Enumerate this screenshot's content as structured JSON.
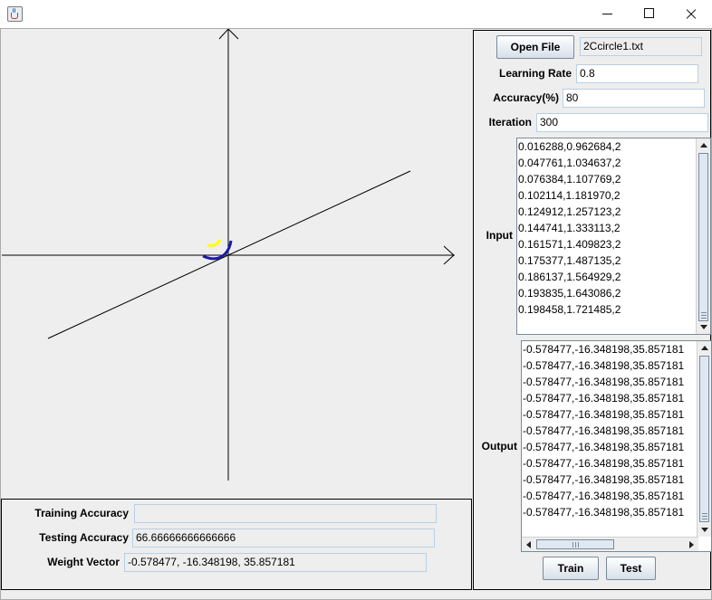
{
  "window": {
    "icon": "java-cup-icon",
    "controls": [
      "minimize-icon",
      "maximize-icon",
      "close-icon"
    ]
  },
  "plot": {
    "colors": {
      "axes": "#000000",
      "line": "#000000",
      "class1": "#1a1aa8",
      "class2": "#ffff00"
    }
  },
  "stats": {
    "training_accuracy_label": "Training Accuracy",
    "training_accuracy_value": "",
    "testing_accuracy_label": "Testing Accuracy",
    "testing_accuracy_value": "66.66666666666666",
    "weight_vector_label": "Weight Vector",
    "weight_vector_value": "-0.578477, -16.348198, 35.857181"
  },
  "controls": {
    "open_file_label": "Open File",
    "file_name": "2Ccircle1.txt",
    "learning_rate_label": "Learning Rate",
    "learning_rate_value": "0.8",
    "accuracy_label": "Accuracy(%)",
    "accuracy_value": "80",
    "iteration_label": "Iteration",
    "iteration_value": "300",
    "input_label": "Input",
    "output_label": "Output",
    "train_label": "Train",
    "test_label": "Test"
  },
  "input_lines": [
    "0.016288,0.962684,2",
    "0.047761,1.034637,2",
    "0.076384,1.107769,2",
    "0.102114,1.181970,2",
    "0.124912,1.257123,2",
    "0.144741,1.333113,2",
    "0.161571,1.409823,2",
    "0.175377,1.487135,2",
    "0.186137,1.564929,2",
    "0.193835,1.643086,2",
    "0.198458,1.721485,2"
  ],
  "output_lines": [
    "-0.578477,-16.348198,35.857181",
    "-0.578477,-16.348198,35.857181",
    "-0.578477,-16.348198,35.857181",
    "-0.578477,-16.348198,35.857181",
    "-0.578477,-16.348198,35.857181",
    "-0.578477,-16.348198,35.857181",
    "-0.578477,-16.348198,35.857181",
    "-0.578477,-16.348198,35.857181",
    "-0.578477,-16.348198,35.857181",
    "-0.578477,-16.348198,35.857181",
    "-0.578477,-16.348198,35.857181"
  ]
}
